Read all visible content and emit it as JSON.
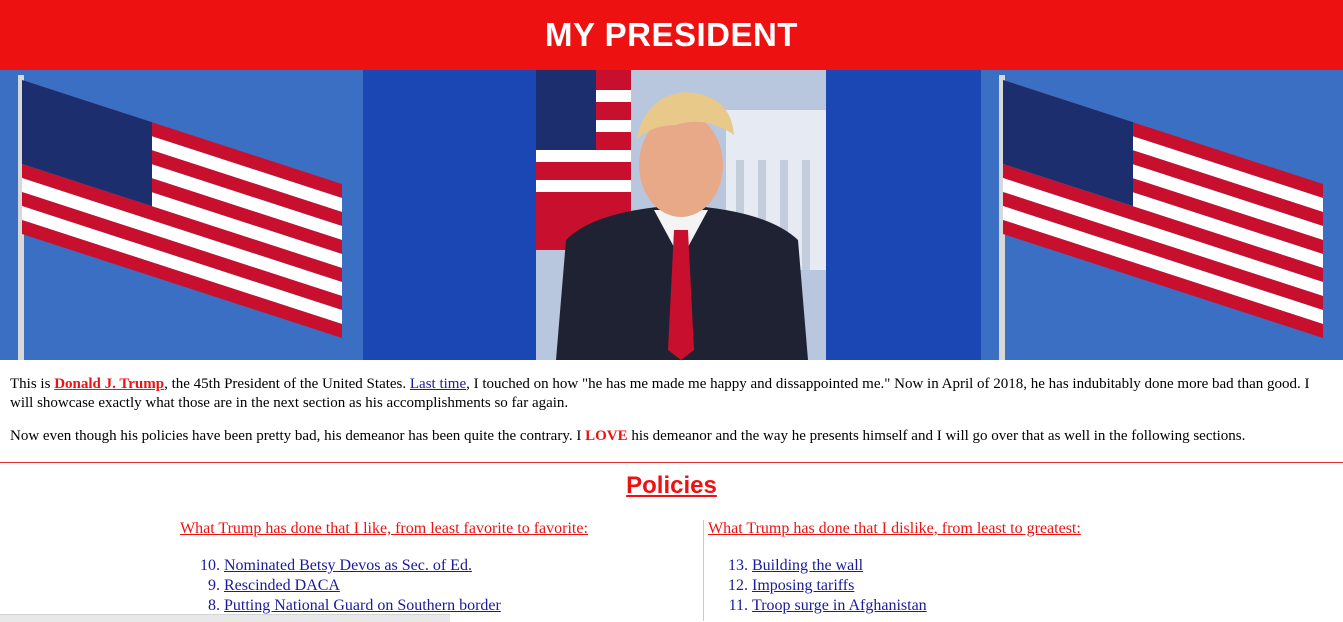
{
  "header": {
    "title": "MY PRESIDENT"
  },
  "intro": {
    "p1_a": "This is ",
    "name": "Donald J. Trump",
    "p1_b": ", the 45th President of the United States. ",
    "last_time": "Last time",
    "p1_c": ", I touched on how \"he has me made me happy and dissappointed me.\" Now in April of 2018, he has indubitably done more bad than good. I will showcase exactly what those are in the next section as his accomplishments so far again.",
    "p2_a": "Now even though his policies have been pretty bad, his demeanor has been quite the contrary. I ",
    "love": "LOVE",
    "p2_b": " his demeanor and the way he presents himself and I will go over that as well in the following sections."
  },
  "policies": {
    "title": "Policies",
    "like_heading": "What Trump has done that I like, from least favorite to favorite:",
    "dislike_heading": "What Trump has done that I dislike, from least to greatest:",
    "likes": [
      {
        "num": "10.",
        "text": "Nominated Betsy Devos as Sec. of Ed."
      },
      {
        "num": "9.",
        "text": "Rescinded DACA"
      },
      {
        "num": "8.",
        "text": "Putting National Guard on Southern border"
      }
    ],
    "dislikes": [
      {
        "num": "13.",
        "text": "Building the wall"
      },
      {
        "num": "12.",
        "text": "Imposing tariffs"
      },
      {
        "num": "11.",
        "text": "Troop surge in Afghanistan"
      }
    ]
  },
  "colors": {
    "header_red": "#ee1111",
    "banner_blue": "#1a47b3",
    "link_blue": "#1a1a9a"
  }
}
